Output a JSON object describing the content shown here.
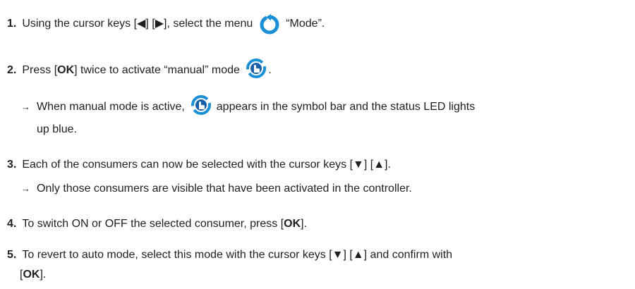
{
  "steps": [
    {
      "num": "1.",
      "pre": "Using the cursor keys [◀] [▶], select the menu",
      "icon": "mode-refresh-icon",
      "post": "“Mode”."
    },
    {
      "num": "2.",
      "pre": "Press [",
      "bold": "OK",
      "mid": "] twice to activate “manual” mode",
      "icon": "manual-mode-icon",
      "post": "."
    },
    {
      "num": "3.",
      "text": "Each of the consumers can now be selected with the cursor keys [▼] [▲]."
    },
    {
      "num": "4.",
      "pre": "To switch ON or OFF the selected consumer, press [",
      "bold": "OK",
      "post": "]."
    },
    {
      "num": "5.",
      "line1": "To revert to auto mode, select this mode with the cursor keys [▼] [▲] and confirm with",
      "line2_pre": "[",
      "bold": "OK",
      "line2_post": "]."
    }
  ],
  "notes": [
    {
      "arrow": "→",
      "pre": "When manual mode is active,",
      "icon": "manual-mode-icon",
      "post": "appears in the symbol bar and the status LED lights",
      "line2": "up blue."
    },
    {
      "arrow": "→",
      "text": "Only those consumers are visible that have been activated in the controller."
    }
  ],
  "colors": {
    "icon_blue": "#1a8fd6",
    "icon_dark": "#1b5fa8"
  }
}
